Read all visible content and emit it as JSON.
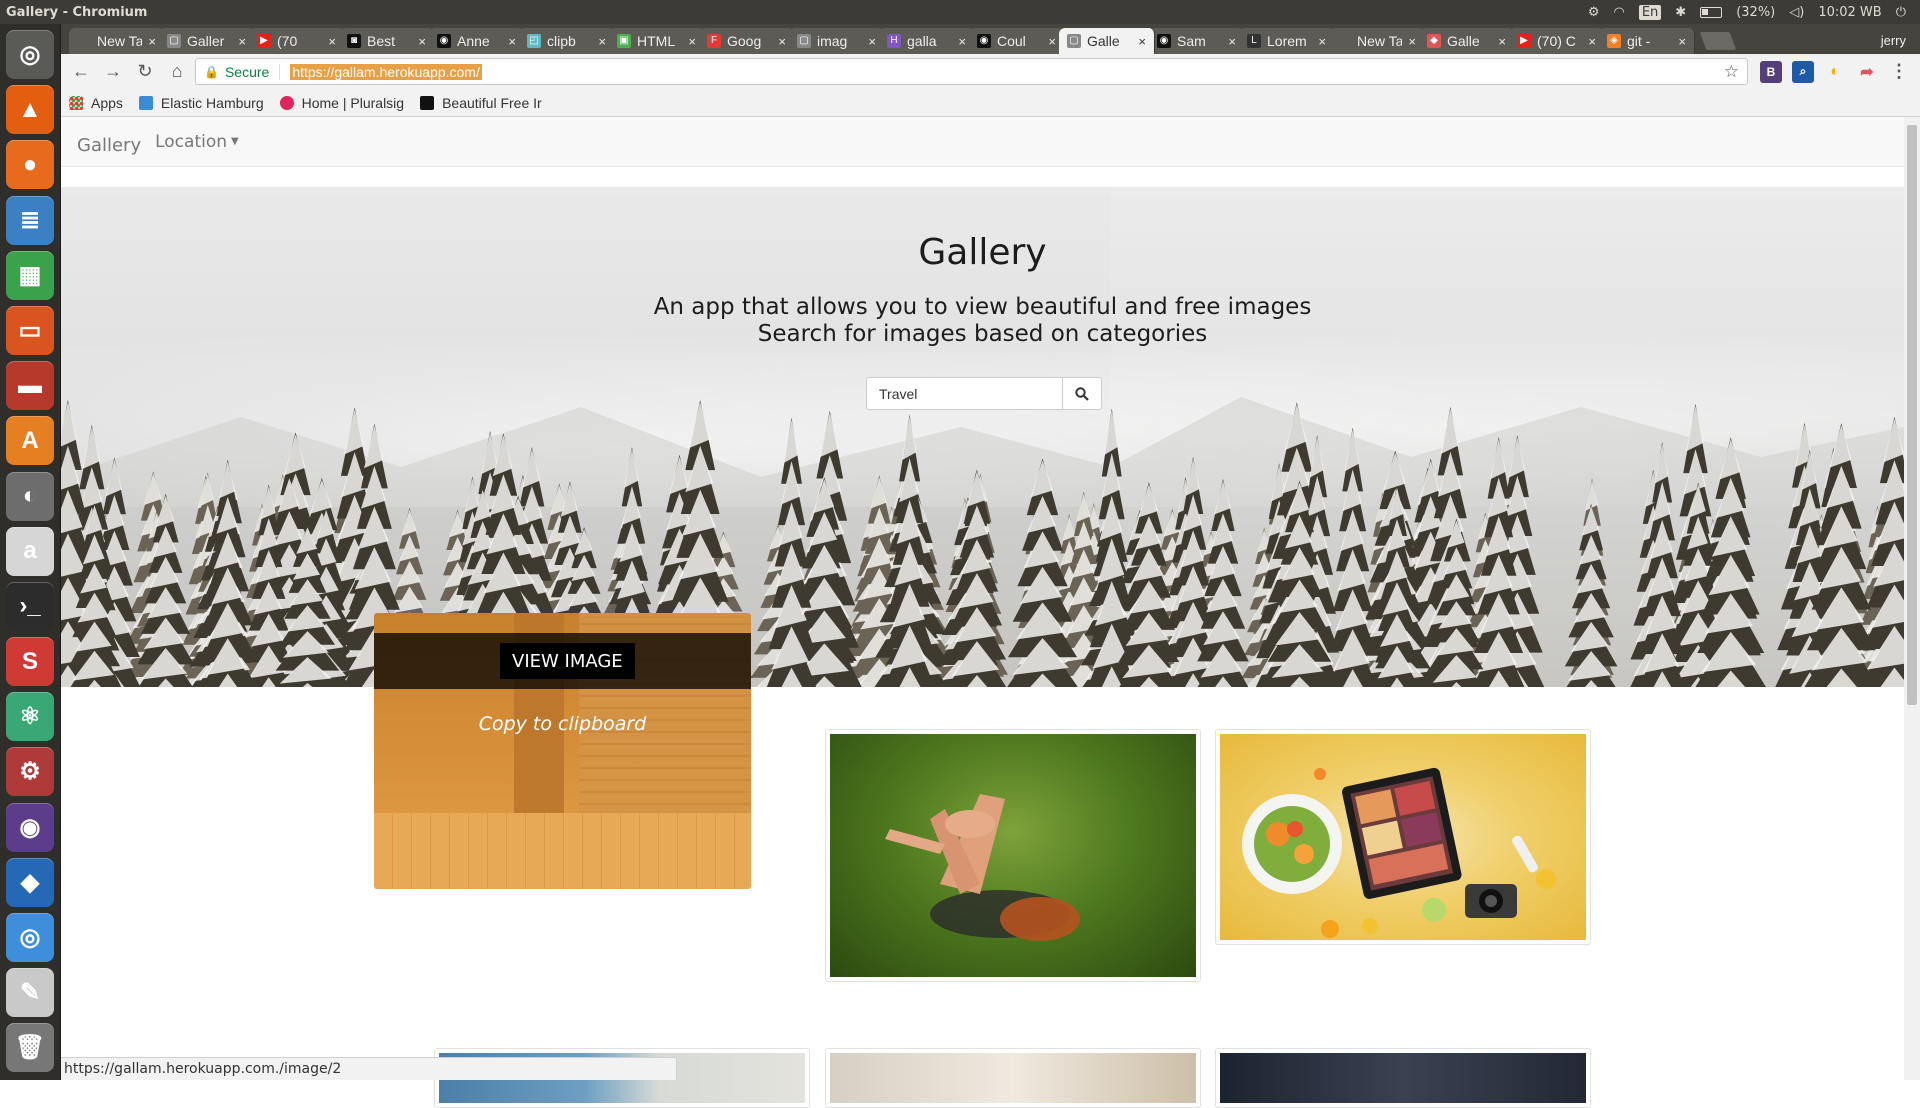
{
  "window": {
    "title": "Gallery - Chromium"
  },
  "top_panel": {
    "keyboard": "En",
    "battery": "(32%)",
    "clock": "10:02 WB"
  },
  "launcher": [
    {
      "name": "ubuntu-dash-icon",
      "glyph": "◎",
      "color": "#5a5a57"
    },
    {
      "name": "vlc-icon",
      "glyph": "▲",
      "color": "#e35f0f"
    },
    {
      "name": "firefox-icon",
      "glyph": "●",
      "color": "#e86a1c"
    },
    {
      "name": "libreoffice-writer-icon",
      "glyph": "≣",
      "color": "#3a80c3"
    },
    {
      "name": "libreoffice-calc-icon",
      "glyph": "▦",
      "color": "#3aa24a"
    },
    {
      "name": "libreoffice-impress-icon",
      "glyph": "▭",
      "color": "#d9541f"
    },
    {
      "name": "files-icon",
      "glyph": "▬",
      "color": "#b6392c"
    },
    {
      "name": "software-center-icon",
      "glyph": "A",
      "color": "#e67e22"
    },
    {
      "name": "system-monitor-icon",
      "glyph": "◐",
      "color": "#6d6d6d"
    },
    {
      "name": "amazon-icon",
      "glyph": "a",
      "color": "#d6d6d6"
    },
    {
      "name": "terminal-icon",
      "glyph": "›_",
      "color": "#2c2c2c"
    },
    {
      "name": "sublime-icon",
      "glyph": "S",
      "color": "#cf3a34"
    },
    {
      "name": "atom-icon",
      "glyph": "⚛",
      "color": "#3aa776"
    },
    {
      "name": "settings-icon",
      "glyph": "⚙",
      "color": "#b03a3a"
    },
    {
      "name": "eclipse-icon",
      "glyph": "◉",
      "color": "#5c3d8c"
    },
    {
      "name": "vscode-icon",
      "glyph": "◆",
      "color": "#2568b5"
    },
    {
      "name": "chromium-icon",
      "glyph": "◎",
      "color": "#3f8edb"
    },
    {
      "name": "text-editor-icon",
      "glyph": "✎",
      "color": "#c9c9c9"
    },
    {
      "name": "trash-icon",
      "glyph": "🗑",
      "color": "#777"
    }
  ],
  "tabs": [
    {
      "label": "New Tab",
      "icon": "",
      "color": "transparent"
    },
    {
      "label": "Galler",
      "icon": "▢",
      "color": "#888"
    },
    {
      "label": "(70",
      "icon": "▶",
      "color": "#e62117"
    },
    {
      "label": "Best",
      "icon": "◙",
      "color": "#111"
    },
    {
      "label": "Anne",
      "icon": "◉",
      "color": "#111"
    },
    {
      "label": "clipb",
      "icon": "◰",
      "color": "#5fb8c2"
    },
    {
      "label": "HTML",
      "icon": "▣",
      "color": "#4caf50"
    },
    {
      "label": "Goog",
      "icon": "F",
      "color": "#e53935"
    },
    {
      "label": "imag",
      "icon": "▢",
      "color": "#888"
    },
    {
      "label": "galla",
      "icon": "H",
      "color": "#7e57c2"
    },
    {
      "label": "Coul",
      "icon": "◉",
      "color": "#111"
    },
    {
      "label": "Galle",
      "icon": "▢",
      "color": "#888",
      "active": true
    },
    {
      "label": "Sam",
      "icon": "◉",
      "color": "#111"
    },
    {
      "label": "Lorem",
      "icon": "L",
      "color": "#333"
    },
    {
      "label": "New Tab",
      "icon": "",
      "color": "transparent"
    },
    {
      "label": "Galle",
      "icon": "◆",
      "color": "#e05555"
    },
    {
      "label": "(70) C",
      "icon": "▶",
      "color": "#e62117"
    },
    {
      "label": "git -",
      "icon": "◈",
      "color": "#f48024"
    }
  ],
  "tab_close": "×",
  "user_name": "jerry",
  "toolbar": {
    "back": "←",
    "forward": "→",
    "reload": "↻",
    "home": "⌂",
    "secure_label": "Secure",
    "url": "https://gallam.herokuapp.com/",
    "star": "☆"
  },
  "extensions": [
    {
      "name": "bootstrap-extension-icon",
      "glyph": "B",
      "color": "#563d7c"
    },
    {
      "name": "search-extension-icon",
      "glyph": "⌕",
      "color": "#1e5aa8"
    },
    {
      "name": "moon-extension-icon",
      "glyph": "◐",
      "color": "#f2b400"
    },
    {
      "name": "share-extension-icon",
      "glyph": "➦",
      "color": "#e05555"
    },
    {
      "name": "menu-icon",
      "glyph": "⋮",
      "color": "#555"
    }
  ],
  "bookmarks": [
    {
      "label": "Apps",
      "name": "apps-icon",
      "color": "#d44"
    },
    {
      "label": "Elastic Hamburg",
      "name": "elastic-icon",
      "color": "#3a8ad6"
    },
    {
      "label": "Home | Pluralsig",
      "name": "pluralsight-icon",
      "color": "#e0245e"
    },
    {
      "label": "Beautiful Free Ir",
      "name": "camera-icon",
      "color": "#111"
    }
  ],
  "site": {
    "brand": "Gallery",
    "location_menu": "Location",
    "hero_title": "Gallery",
    "hero_sub_1": "An app that allows you to view beautiful and free images",
    "hero_sub_2": "Search for images based on categories",
    "search_value": "Travel"
  },
  "gallery": {
    "view_image": "VIEW IMAGE",
    "copy_to_clipboard": "Copy to clipboard"
  },
  "status_url": "https://gallam.herokuapp.com./image/2"
}
